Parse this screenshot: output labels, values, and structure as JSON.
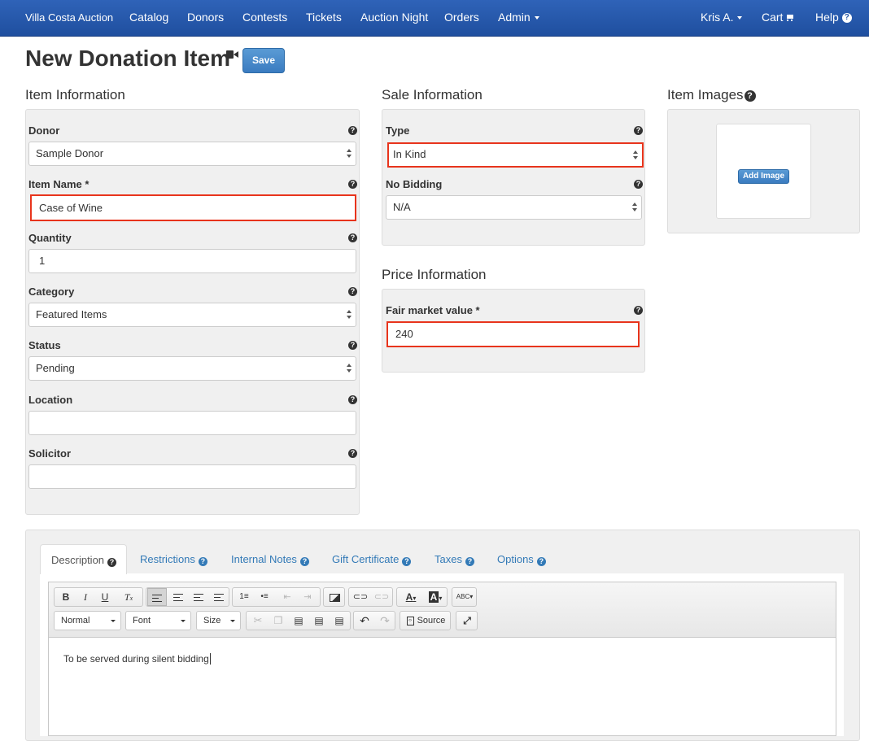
{
  "navbar": {
    "brand": "Villa Costa Auction",
    "items": [
      {
        "label": "Catalog"
      },
      {
        "label": "Donors"
      },
      {
        "label": "Contests"
      },
      {
        "label": "Tickets"
      },
      {
        "label": "Auction Night"
      },
      {
        "label": "Orders"
      },
      {
        "label": "Admin"
      }
    ],
    "user": "Kris A.",
    "cart": "Cart",
    "help": "Help"
  },
  "page": {
    "title": "New Donation Item",
    "save_label": "Save"
  },
  "item_info": {
    "title": "Item Information",
    "donor_label": "Donor",
    "donor_value": "Sample Donor",
    "item_name_label": "Item Name *",
    "item_name_value": "Case of Wine",
    "quantity_label": "Quantity",
    "quantity_value": "1",
    "category_label": "Category",
    "category_value": "Featured Items",
    "status_label": "Status",
    "status_value": "Pending",
    "location_label": "Location",
    "location_value": "",
    "solicitor_label": "Solicitor",
    "solicitor_value": ""
  },
  "sale_info": {
    "title": "Sale Information",
    "type_label": "Type",
    "type_value": "In Kind",
    "no_bidding_label": "No Bidding",
    "no_bidding_value": "N/A"
  },
  "price_info": {
    "title": "Price Information",
    "fmv_label": "Fair market value *",
    "fmv_value": "240"
  },
  "images": {
    "title": "Item Images",
    "add_label": "Add Image"
  },
  "tabs": [
    {
      "label": "Description"
    },
    {
      "label": "Restrictions"
    },
    {
      "label": "Internal Notes"
    },
    {
      "label": "Gift Certificate"
    },
    {
      "label": "Taxes"
    },
    {
      "label": "Options"
    }
  ],
  "editor": {
    "format": "Normal",
    "font": "Font",
    "size": "Size",
    "source_label": "Source",
    "content": "To be served during silent bidding"
  },
  "icons": [
    "video-icon",
    "help-icon",
    "cart-icon",
    "caret-icon",
    "image-icon",
    "link-icon",
    "unlink-icon",
    "maximize-icon",
    "spellcheck-icon",
    "undo-icon",
    "redo-icon"
  ],
  "colors": {
    "navbar": "#2a5aa9",
    "primary_button": "#3a7bc0",
    "link": "#337ab7",
    "highlight_border": "#e8341c",
    "panel_bg": "#f0f0f0"
  }
}
